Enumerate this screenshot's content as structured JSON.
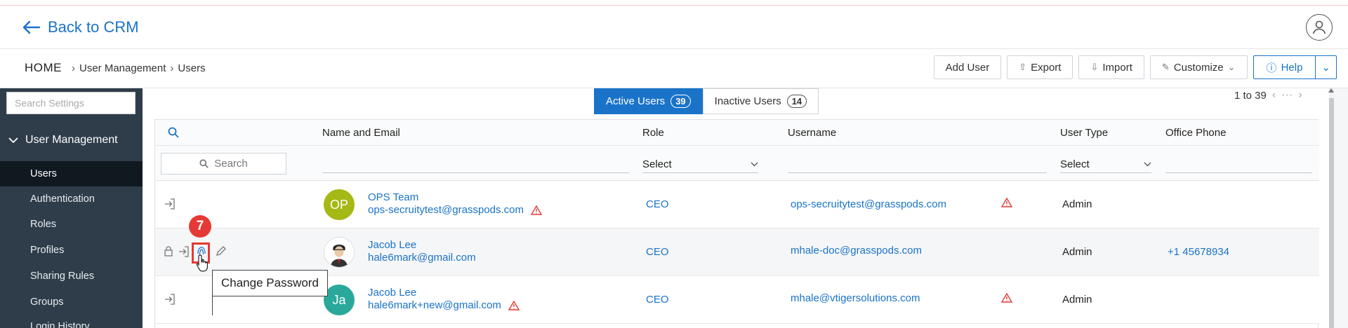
{
  "topbar": {
    "back_label": "Back to CRM"
  },
  "breadcrumb": {
    "home": "HOME",
    "items": [
      "User Management",
      "Users"
    ]
  },
  "actions": {
    "add_user": "Add User",
    "export": "Export",
    "import": "Import",
    "customize": "Customize",
    "help": "Help"
  },
  "sidebar": {
    "search_placeholder": "Search Settings",
    "section": "User Management",
    "items": [
      {
        "label": "Users",
        "active": true
      },
      {
        "label": "Authentication"
      },
      {
        "label": "Roles"
      },
      {
        "label": "Profiles"
      },
      {
        "label": "Sharing Rules"
      },
      {
        "label": "Groups"
      },
      {
        "label": "Login History"
      }
    ]
  },
  "tabs": {
    "active": {
      "label": "Active Users",
      "count": "39"
    },
    "inactive": {
      "label": "Inactive Users",
      "count": "14"
    }
  },
  "pager": {
    "range": "1 to 39",
    "more": "···"
  },
  "table": {
    "headers": {
      "name": "Name and Email",
      "role": "Role",
      "username": "Username",
      "user_type": "User Type",
      "phone": "Office Phone"
    },
    "filters": {
      "search": "Search",
      "role_select": "Select",
      "type_select": "Select"
    },
    "rows": [
      {
        "initials": "OP",
        "avatar_color": "#a5b814",
        "name": "OPS Team",
        "email": "ops-secruitytest@grasspods.com",
        "role": "CEO",
        "username": "ops-secruitytest@grasspods.com",
        "user_type": "Admin",
        "phone": ""
      },
      {
        "initials": "",
        "avatar_color": "#ffffff",
        "name": "Jacob Lee",
        "email": "hale6mark@gmail.com",
        "role": "CEO",
        "username": "mhale-doc@grasspods.com",
        "user_type": "Admin",
        "phone": "+1 45678934"
      },
      {
        "initials": "Ja",
        "avatar_color": "#2aa99b",
        "name": "Jacob Lee",
        "email": "hale6mark+new@gmail.com",
        "role": "CEO",
        "username": "mhale@vtigersolutions.com",
        "user_type": "Admin",
        "phone": ""
      }
    ]
  },
  "annotation": {
    "step": "7",
    "tooltip": "Change Password"
  },
  "colors": {
    "accent": "#1a73c9",
    "sidebar": "#2f3d4a",
    "warning": "#e53935"
  }
}
